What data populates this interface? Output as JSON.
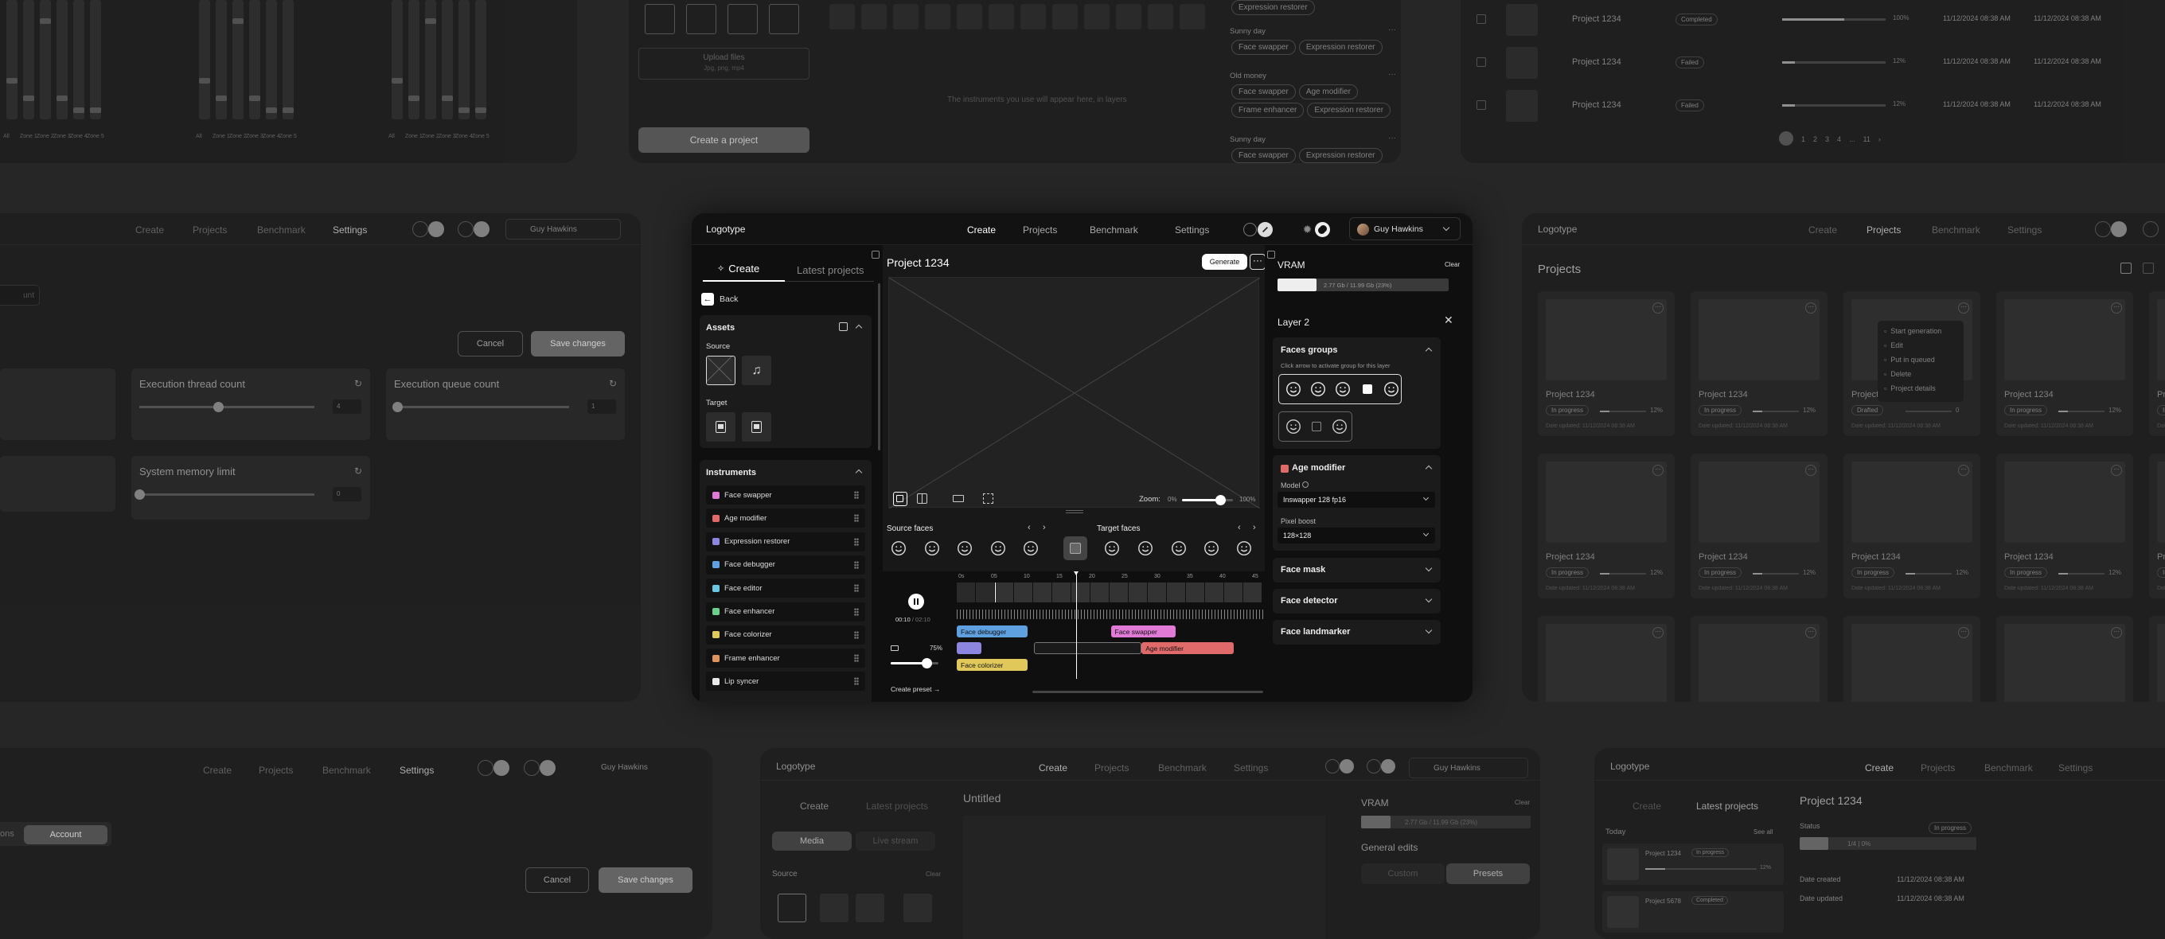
{
  "bg": {
    "eq_labels": [
      "All",
      "Zone 1",
      "Zone 2",
      "Zone 3",
      "Zone 4",
      "Zone 5"
    ],
    "create_project_btn": "Create a project",
    "upload_files": "Upload files",
    "upload_hint": "Jpg, png, mp4",
    "instruments_hint": "The instruments you use will appear here, in layers",
    "presets": [
      {
        "name": "",
        "chips": [
          "Expression restorer"
        ]
      },
      {
        "name": "Sunny day",
        "chips": [
          "Face swapper",
          "Expression restorer"
        ]
      },
      {
        "name": "Old money",
        "chips": [
          "Face swapper",
          "Age modifier",
          "Frame enhancer",
          "Expression restorer"
        ]
      },
      {
        "name": "Sunny day",
        "chips": [
          "Face swapper",
          "Expression restorer"
        ]
      }
    ],
    "table_rows": [
      {
        "name": "Project 1234",
        "status": "Completed",
        "progress": 0.6,
        "pct": "100%",
        "date1": "11/12/2024 08:38 AM",
        "date2": "11/12/2024 08:38 AM"
      },
      {
        "name": "Project 1234",
        "status": "Failed",
        "progress": 0.12,
        "pct": "12%",
        "date1": "11/12/2024 08:38 AM",
        "date2": "11/12/2024 08:38 AM"
      },
      {
        "name": "Project 1234",
        "status": "Failed",
        "progress": 0.12,
        "pct": "12%",
        "date1": "11/12/2024 08:38 AM",
        "date2": "11/12/2024 08:38 AM"
      }
    ],
    "pagination": [
      "1",
      "2",
      "3",
      "4",
      "...",
      "11"
    ],
    "settings": {
      "nav": [
        "Create",
        "Projects",
        "Benchmark",
        "Settings"
      ],
      "user": "Guy Hawkins",
      "cancel": "Cancel",
      "save": "Save changes",
      "field": "unt",
      "cards": [
        {
          "title": "Execution thread count",
          "value": "4",
          "level": 0.45
        },
        {
          "title": "Execution queue count",
          "value": "1",
          "level": 0.02
        },
        {
          "title": "System memory limit",
          "value": "0",
          "level": 0.0
        }
      ],
      "account_tab": "Account",
      "ons_tab": "ons"
    },
    "projects_page": {
      "logo": "Logotype",
      "nav": [
        "Create",
        "Projects",
        "Benchmark",
        "Settings"
      ],
      "title": "Projects",
      "card_name": "Project 1234",
      "card_date": "Date updated: 11/12/2024 08:38 AM",
      "in_progress": "In progress",
      "drafted": "Drafted",
      "pct": "12%",
      "zero": "0",
      "menu": [
        "Start generation",
        "Edit",
        "Put in queued",
        "Delete",
        "Project details"
      ]
    },
    "bottom_create": {
      "logo": "Logotype",
      "nav": [
        "Create",
        "Projects",
        "Benchmark",
        "Settings"
      ],
      "user": "Guy Hawkins",
      "tabs": [
        "Create",
        "Latest projects"
      ],
      "untitled": "Untitled",
      "media": "Media",
      "live": "Live stream",
      "source": "Source",
      "clear": "Clear",
      "vram": "VRAM",
      "vram_value": "2.77 Gb / 11.99 Gb (23%)",
      "general_edits": "General edits",
      "custom": "Custom",
      "presets": "Presets"
    },
    "bottom_latest": {
      "logo": "Logotype",
      "nav": [
        "Create",
        "Projects",
        "Benchmark",
        "Settings"
      ],
      "tabs": [
        "Create",
        "Latest projects"
      ],
      "today": "Today",
      "see_all": "See all",
      "items": [
        {
          "name": "Project 1234",
          "status": "In progress",
          "pct": "12%"
        },
        {
          "name": "Project 5678",
          "status": "Completed",
          "pct": ""
        }
      ],
      "project_title": "Project 1234",
      "status_label": "Status",
      "status_value": "In progress",
      "status_progress": "1/4 | 0%",
      "date_created_label": "Date created",
      "date_created": "11/12/2024 08:38 AM",
      "date_updated_label": "Date updated",
      "date_updated": "11/12/2024 08:38 AM"
    }
  },
  "app": {
    "logo": "Logotype",
    "nav": [
      "Create",
      "Projects",
      "Benchmark",
      "Settings"
    ],
    "active_nav": "Create",
    "user": "Guy Hawkins",
    "left": {
      "tabs": [
        "Create",
        "Latest projects"
      ],
      "back": "Back",
      "assets_title": "Assets",
      "source_label": "Source",
      "target_label": "Target",
      "instruments_title": "Instruments",
      "instruments": [
        {
          "name": "Face swapper",
          "color": "#e07ad6"
        },
        {
          "name": "Age modifier",
          "color": "#e06a6a"
        },
        {
          "name": "Expression restorer",
          "color": "#8d86e0"
        },
        {
          "name": "Face debugger",
          "color": "#5fa0e0"
        },
        {
          "name": "Face editor",
          "color": "#6cc7e0"
        },
        {
          "name": "Face enhancer",
          "color": "#6ad08b"
        },
        {
          "name": "Face colorizer",
          "color": "#e0c95a"
        },
        {
          "name": "Frame enhancer",
          "color": "#e0935a"
        },
        {
          "name": "Lip syncer",
          "color": "#e8e8e8"
        }
      ]
    },
    "center": {
      "project_title": "Project 1234",
      "generate": "Generate",
      "zoom_label": "Zoom:",
      "zoom_min": "0%",
      "zoom_max": "100%",
      "zoom_level": 0.75,
      "source_faces": "Source faces",
      "target_faces": "Target faces",
      "time_ticks": [
        "0s",
        "05",
        "10",
        "15",
        "20",
        "25",
        "30",
        "35",
        "40",
        "45"
      ],
      "time_current": "00:10",
      "time_total": "02:10",
      "volume": "75%",
      "volume_level": 0.75,
      "create_preset": "Create preset",
      "clips": [
        {
          "label": "Face debugger",
          "color": "#5fa0e0",
          "lane": 0,
          "start": 0.0,
          "end": 0.23
        },
        {
          "label": "Face swapper",
          "color": "#e07ad6",
          "lane": 0,
          "start": 0.5,
          "end": 0.71
        },
        {
          "label": "",
          "color": "#8d86e0",
          "lane": 1,
          "start": 0.0,
          "end": 0.08
        },
        {
          "label": "",
          "color": "#1a1a1a",
          "lane": 1,
          "start": 0.25,
          "end": 0.6
        },
        {
          "label": "Age modifier",
          "color": "#e06a6a",
          "lane": 1,
          "start": 0.6,
          "end": 0.9
        },
        {
          "label": "Face colorizer",
          "color": "#e0c95a",
          "lane": 2,
          "start": 0.0,
          "end": 0.23
        }
      ]
    },
    "right": {
      "vram_title": "VRAM",
      "clear": "Clear",
      "vram_value": "2.77 Gb / 11.99 Gb (23%)",
      "vram_level": 0.23,
      "layer_title": "Layer 2",
      "faces_groups_title": "Faces groups",
      "faces_groups_hint": "Click arrow to activate group for this layer",
      "age_modifier_title": "Age modifier",
      "model_label": "Model",
      "model_value": "Inswapper 128 fp16",
      "pixel_boost_label": "Pixel boost",
      "pixel_boost_value": "128×128",
      "face_mask": "Face mask",
      "face_detector": "Face detector",
      "face_landmarker": "Face landmarker"
    }
  }
}
